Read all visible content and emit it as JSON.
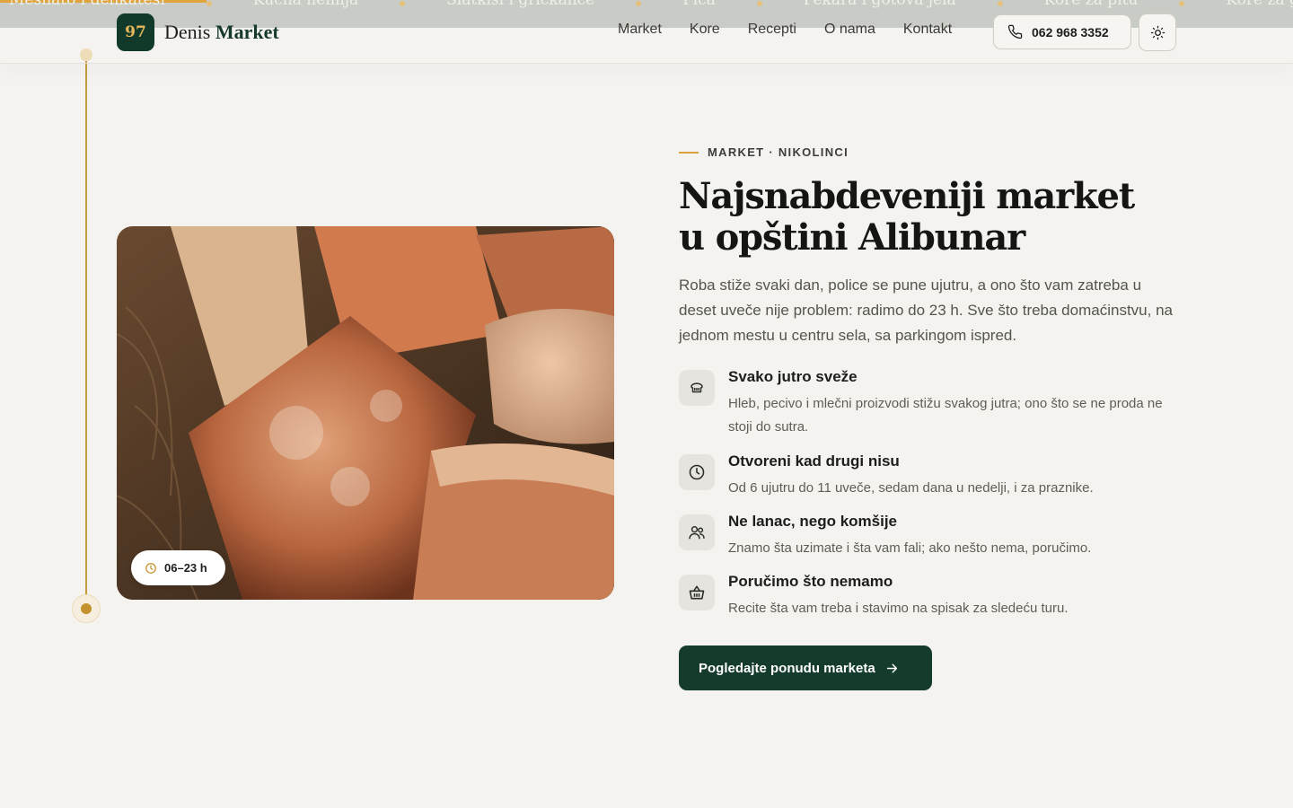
{
  "ticker": {
    "progress_percent": 16,
    "items": [
      "Mesnato i delikatesi",
      "Kućna hemija",
      "Slatkiši i grickalice",
      "Pića",
      "Pekara i gotova jela",
      "Kore za pitu",
      "Kore za gibanicu"
    ]
  },
  "header": {
    "logo_badge": "97",
    "brand_first": "Denis",
    "brand_second": "Market",
    "nav": [
      "Market",
      "Kore",
      "Recepti",
      "O nama",
      "Kontakt"
    ],
    "phone": "062 968 3352",
    "theme_icon": "sun-icon"
  },
  "hero": {
    "hours_badge": "06–23 h",
    "eyebrow": "MARKET · NIKOLINCI",
    "headline_line1": "Najsnabdeveniji market",
    "headline_line2": "u opštini Alibunar",
    "lead": "Roba stiže svaki dan, police se pune ujutru, a ono što vam zatreba u deset uveče nije problem: radimo do 23 h. Sve što treba domaćinstvu, na jednom mestu u centru sela, sa parkingom ispred.",
    "features": [
      {
        "icon": "bread-icon",
        "title": "Svako jutro sveže",
        "desc": "Hleb, pecivo i mlečni proizvodi stižu svakog jutra; ono što se ne proda ne stoji do sutra."
      },
      {
        "icon": "clock-icon",
        "title": "Otvoreni kad drugi nisu",
        "desc": "Od 6 ujutru do 11 uveče, sedam dana u nedelji, i za praznike."
      },
      {
        "icon": "people-icon",
        "title": "Ne lanac, nego komšije",
        "desc": "Znamo šta uzimate i šta vam fali; ako nešto nema, poručimo."
      },
      {
        "icon": "basket-icon",
        "title": "Poručimo što nemamo",
        "desc": "Recite šta vam treba i stavimo na spisak za sledeću turu."
      }
    ],
    "cta_label": "Pogledajte ponudu marketa"
  },
  "colors": {
    "background": "#f4f3ef",
    "brand_green": "#143b2c",
    "accent_gold": "#d8a241"
  }
}
